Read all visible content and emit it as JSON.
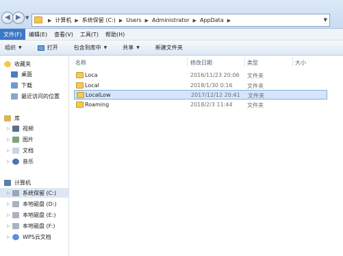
{
  "address_bar": {
    "breadcrumbs": [
      "计算机",
      "系统保留 (C:)",
      "Users",
      "Administrator",
      "AppData"
    ]
  },
  "menu": [
    "文件(F)",
    "编辑(E)",
    "查看(V)",
    "工具(T)",
    "帮助(H)"
  ],
  "commands": {
    "organize": "组织",
    "open": "打开",
    "include_in_library": "包含到库中",
    "share": "共享",
    "new_folder": "新建文件夹"
  },
  "sidebar": {
    "favorites": "收藏夹",
    "desktop": "桌面",
    "downloads": "下载",
    "recent": "最近访问的位置",
    "library": "库",
    "videos": "视频",
    "pictures": "图片",
    "documents": "文档",
    "music": "音乐",
    "computer": "计算机",
    "drive_c": "系统保留 (C:)",
    "drive_d": "本地磁盘 (D:)",
    "drive_e": "本地磁盘 (E:)",
    "drive_f": "本地磁盘 (F:)",
    "wps": "WPS云文档"
  },
  "columns": {
    "name": "名称",
    "modified": "修改日期",
    "type": "类型",
    "size": "大小"
  },
  "files": [
    {
      "name": "Loca",
      "modified": "2016/11/23 20:06",
      "type": "文件夹"
    },
    {
      "name": "Local",
      "modified": "2018/1/30 0:16",
      "type": "文件夹"
    },
    {
      "name": "LocalLow",
      "modified": "2017/12/12 20:41",
      "type": "文件夹"
    },
    {
      "name": "Roaming",
      "modified": "2018/2/3 11:44",
      "type": "文件夹"
    }
  ],
  "colors": {
    "accent": "#3a78c8",
    "selection": "#d5e6fb"
  }
}
